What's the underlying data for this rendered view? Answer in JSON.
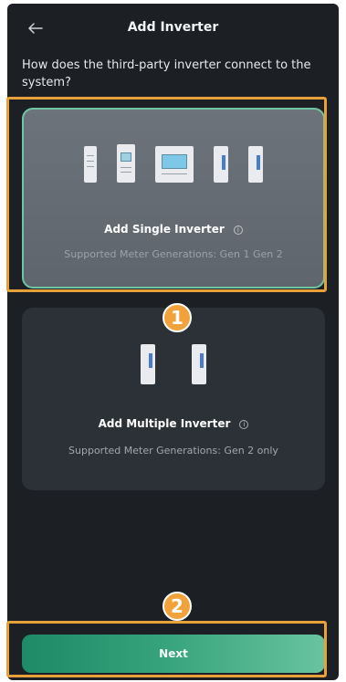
{
  "header": {
    "title": "Add Inverter",
    "back_icon": "arrow-left-icon"
  },
  "question": "How does the third-party inverter connect to the system?",
  "options": [
    {
      "label": "Add Single Inverter",
      "subtitle": "Supported Meter Generations: Gen 1 Gen 2",
      "selected": true
    },
    {
      "label": "Add Multiple Inverter",
      "subtitle": "Supported Meter Generations: Gen 2 only",
      "selected": false
    }
  ],
  "callouts": [
    "1",
    "2"
  ],
  "footer": {
    "next_label": "Next"
  },
  "colors": {
    "background": "#1c1f24",
    "selected_border": "#6fc6a4",
    "highlight": "#e8a13a",
    "button_gradient_start": "#1e8a66",
    "button_gradient_end": "#69c3a0"
  }
}
